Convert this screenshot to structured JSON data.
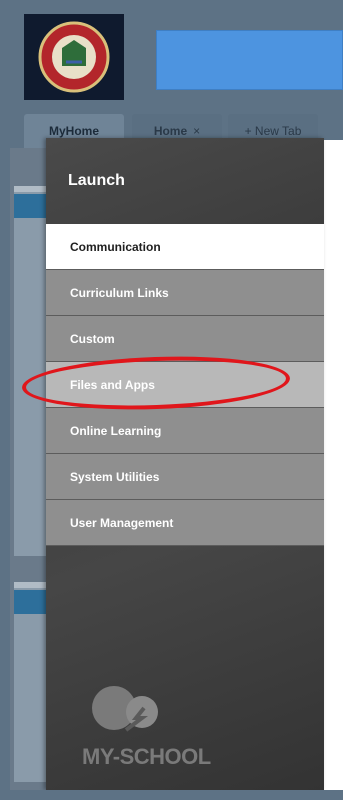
{
  "tabs": [
    {
      "label": "MyHome"
    },
    {
      "label": "Home",
      "close": "×"
    },
    {
      "label": "+ New Tab"
    }
  ],
  "launch": {
    "title": "Launch",
    "items": [
      {
        "label": "Communication"
      },
      {
        "label": "Curriculum Links"
      },
      {
        "label": "Custom"
      },
      {
        "label": "Files and Apps"
      },
      {
        "label": "Online Learning"
      },
      {
        "label": "System Utilities"
      },
      {
        "label": "User Management"
      }
    ],
    "active_item": "Communication",
    "highlighted_item": "Files and Apps"
  },
  "brand": {
    "text": "MY-SCHOOL"
  },
  "colors": {
    "header": "#5d7285",
    "search_bar": "#4d94e0",
    "highlight": "#e0161b",
    "panel": "#3a3a3a"
  }
}
